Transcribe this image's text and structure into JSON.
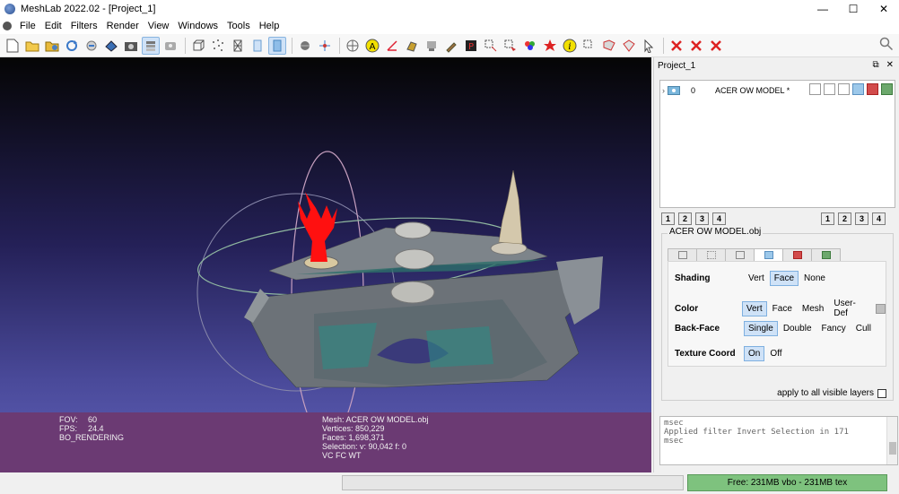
{
  "window": {
    "title": "MeshLab 2022.02 - [Project_1]",
    "controls": [
      "—",
      "☐",
      "✕"
    ]
  },
  "menu": [
    "File",
    "Edit",
    "Filters",
    "Render",
    "View",
    "Windows",
    "Tools",
    "Help"
  ],
  "toolbar": {
    "icons": [
      "new-project-icon",
      "open-project-icon",
      "open-mesh-icon",
      "reload-icon",
      "reload-all-icon",
      "save-icon",
      "snapshot-icon",
      "layers-icon",
      "rasters-icon",
      "bbox-icon",
      "points-icon",
      "wireframe-icon",
      "flat-icon",
      "smooth-icon",
      "light-icon",
      "axis-icon",
      "info-icon",
      "measure-icon",
      "align-icon",
      "paint-icon",
      "select-faces-icon",
      "select-vertices-icon",
      "color-icon",
      "delete-icon",
      "search-icon"
    ]
  },
  "viewport": {
    "info_left": {
      "fov_label": "FOV:",
      "fov_value": "60",
      "fps_label": "FPS:",
      "fps_value": "24.4",
      "rendering": "BO_RENDERING"
    },
    "info_right": {
      "mesh": "Mesh: ACER OW MODEL.obj",
      "vertices": "Vertices: 850,229",
      "faces": "Faces: 1,698,371",
      "selection": "Selection: v: 90,042 f: 0",
      "flags": "VC FC WT"
    }
  },
  "dock": {
    "title": "Project_1",
    "float_icon": "⧉",
    "close_icon": "✕",
    "layer": {
      "expander": "›",
      "id": "0",
      "name": "ACER OW MODEL *"
    },
    "num_buttons_left": [
      "1",
      "2",
      "3",
      "4"
    ],
    "num_buttons_right": [
      "1",
      "2",
      "3",
      "4"
    ],
    "props_title": "ACER OW MODEL.obj",
    "tabs": [
      "bbox-tab",
      "points-tab",
      "wire-tab",
      "flat-tab",
      "texture-tab",
      "extra-tab"
    ],
    "rows": [
      {
        "label": "Shading",
        "options": [
          "Vert",
          "Face",
          "None"
        ],
        "selected": 1
      },
      {
        "label": "Color",
        "options": [
          "Vert",
          "Face",
          "Mesh",
          "User-Def"
        ],
        "selected": 0
      },
      {
        "label": "Back-Face",
        "options": [
          "Single",
          "Double",
          "Fancy",
          "Cull"
        ],
        "selected": 0
      },
      {
        "label": "Texture Coord",
        "options": [
          "On",
          "Off"
        ],
        "selected": 0
      }
    ],
    "apply_all_label": "apply to all visible layers",
    "log_lines": [
      "msec",
      "Applied filter Invert Selection in 171",
      "msec"
    ]
  },
  "status": {
    "memory": "Free: 231MB vbo - 231MB tex"
  },
  "colors": {
    "viewport_top": "#050505",
    "viewport_bottom": "#6060b8",
    "info_bar": "#6b3a73",
    "memory_bar": "#7ec27e",
    "selection_red": "#ff1010"
  }
}
